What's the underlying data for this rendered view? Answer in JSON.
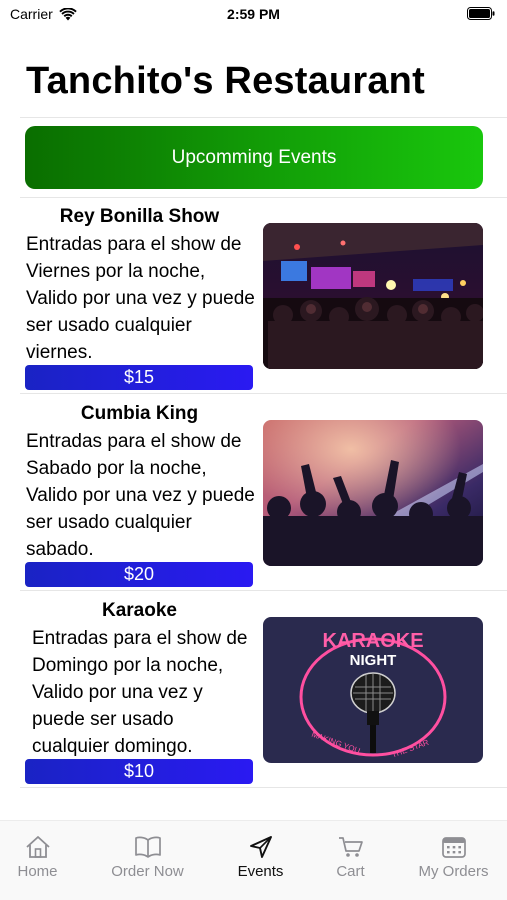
{
  "status_bar": {
    "carrier": "Carrier",
    "time": "2:59 PM"
  },
  "header": {
    "title": "Tanchito's Restaurant"
  },
  "banner": {
    "label": "Upcomming Events"
  },
  "events": [
    {
      "title": "Rey Bonilla Show",
      "description": "Entradas para el show de Viernes por la noche, Valido por una vez y puede ser usado cualquier viernes.",
      "price": "$15",
      "image": "concert-crowd-photo"
    },
    {
      "title": "Cumbia King",
      "description": "Entradas para el show de Sabado por la noche, Valido por una vez y puede ser usado cualquier sabado.",
      "price": "$20",
      "image": "dance-party-photo"
    },
    {
      "title": "Karaoke",
      "description": "Entradas para el show de Domingo por la noche, Valido por una vez y puede ser usado cualquier domingo.",
      "price": "$10",
      "image": "karaoke-night-poster",
      "poster_text": {
        "line1": "KARAOKE",
        "line2": "NIGHT",
        "curve_left": "MAKING YOU",
        "curve_right": "THE STAR"
      }
    }
  ],
  "tab_bar": {
    "tabs": [
      {
        "label": "Home",
        "icon": "home-icon",
        "active": false
      },
      {
        "label": "Order Now",
        "icon": "book-icon",
        "active": false
      },
      {
        "label": "Events",
        "icon": "send-icon",
        "active": true
      },
      {
        "label": "Cart",
        "icon": "cart-icon",
        "active": false
      },
      {
        "label": "My Orders",
        "icon": "calendar-icon",
        "active": false
      }
    ]
  },
  "colors": {
    "banner_start": "#0a6e00",
    "banner_end": "#19c70d",
    "price_start": "#1a23c4",
    "price_end": "#2a1af2",
    "tab_inactive": "#8e8e93",
    "tab_active": "#111111"
  }
}
